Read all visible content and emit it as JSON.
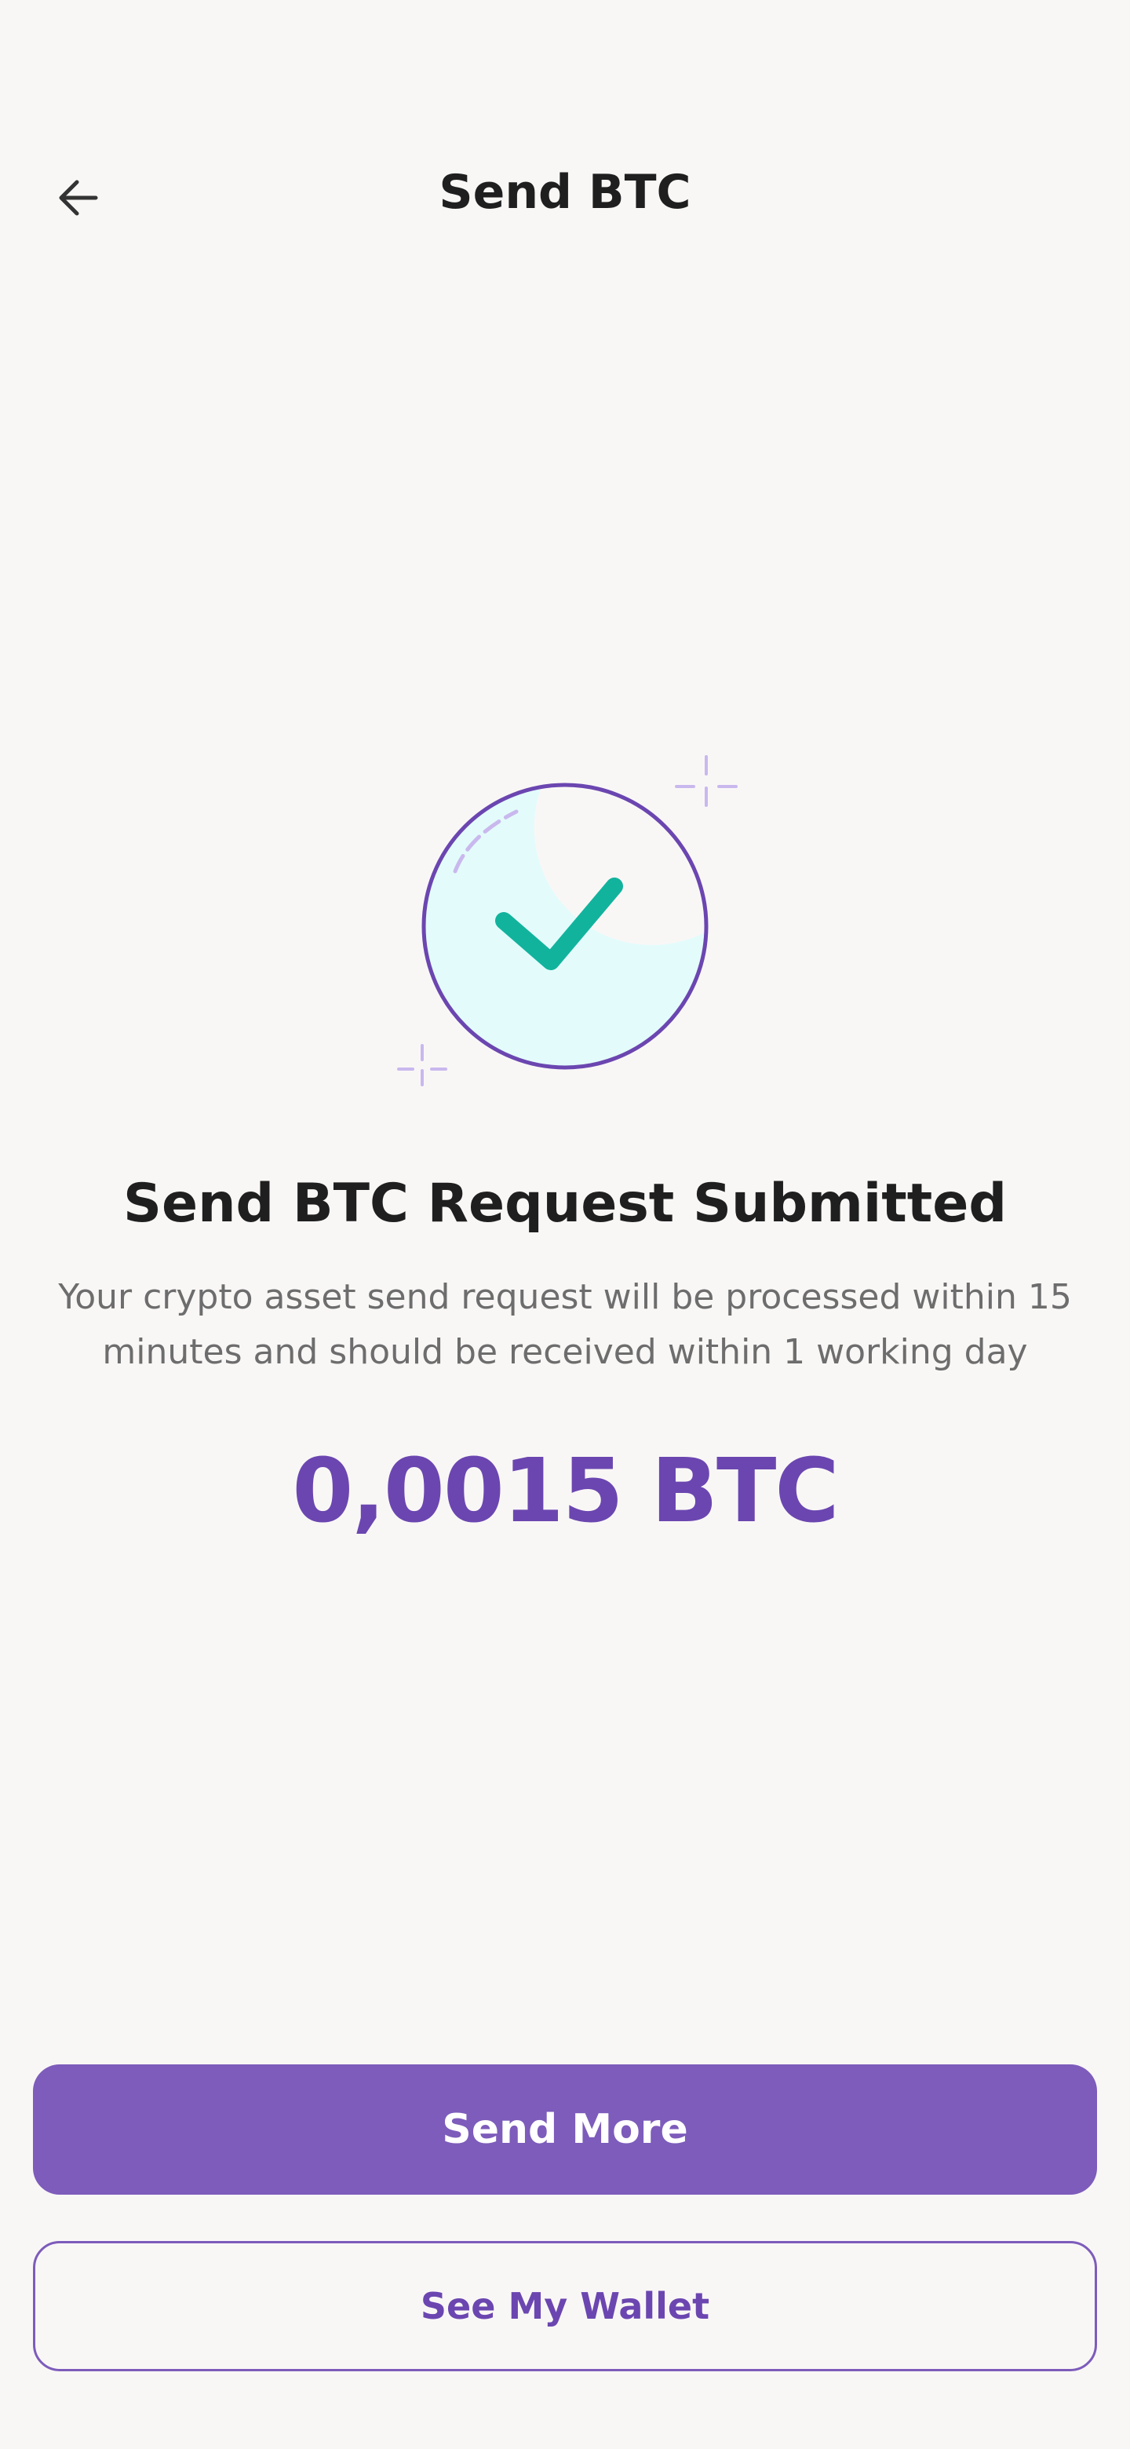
{
  "header": {
    "title": "Send BTC",
    "back_icon": "arrow-left-icon"
  },
  "result": {
    "icon": "check-circle-icon",
    "title": "Send BTC Request Submitted",
    "description": "Your crypto asset send request will be processed within 15 minutes and should be received within 1 working day",
    "amount": "0,0015 BTC"
  },
  "actions": {
    "primary_label": "Send More",
    "secondary_label": "See My Wallet"
  },
  "colors": {
    "background": "#f9f7f6",
    "accent": "#7d5cbb",
    "accent_text": "#6b46b0",
    "success": "#12b39d",
    "circle_fill": "#e3fcfb"
  }
}
